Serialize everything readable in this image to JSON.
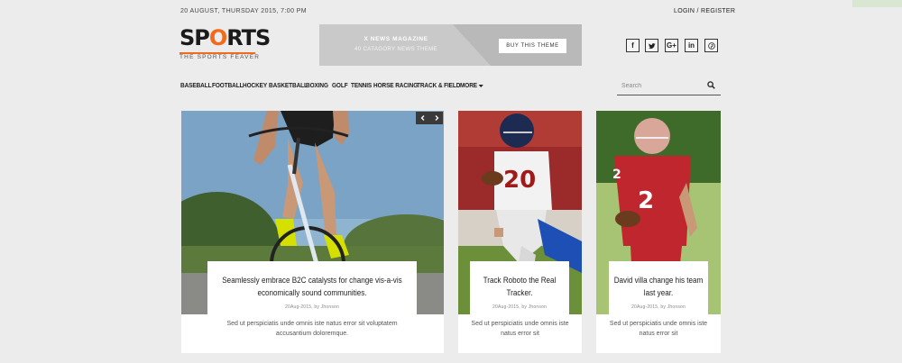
{
  "topbar": {
    "date": "20 AUGUST, THURSDAY 2015, 7:00 PM",
    "login": "LOGIN / REGISTER"
  },
  "logo": {
    "word_start": "SP",
    "word_o": "O",
    "word_end": "RTS",
    "tagline": "THE SPORTS FEAVER",
    "accent_color": "#f26a1b"
  },
  "banner": {
    "title": "X NEWS MAGAZINE",
    "subtitle": "40 CATAGORY NEWS THEME",
    "button": "BUY THIS THEME"
  },
  "social": [
    "f",
    "twitter-icon",
    "G+",
    "in",
    "pinterest-icon"
  ],
  "nav": {
    "items": [
      "BASEBALL",
      "FOOTBALL",
      "HOCKEY",
      "BASKETBALL",
      "BOXING",
      "GOLF",
      "TENNIS",
      "HORSE RACING",
      "TRACK & FIELD"
    ],
    "more": "MORE"
  },
  "search": {
    "placeholder": "Search"
  },
  "cards": [
    {
      "title": "Seamlessly embrace B2C catalysts for change vis-a-vis economically sound communities.",
      "meta": "20Aug-2015, by Jhonson",
      "excerpt": "Sed ut perspiciatis unde omnis iste natus error sit voluptatem accusantium doloremque."
    },
    {
      "title": "Track Roboto the Real Tracker.",
      "meta": "20Aug-2015, by Jhonson",
      "excerpt": "Sed ut perspiciatis unde omnis iste natus error sit"
    },
    {
      "title": "David villa change his team last year.",
      "meta": "20Aug-2015, by Jhonson",
      "excerpt": "Sed ut perspiciatis unde omnis iste natus error sit"
    }
  ],
  "jersey_numbers": [
    "20",
    "2",
    "2"
  ]
}
